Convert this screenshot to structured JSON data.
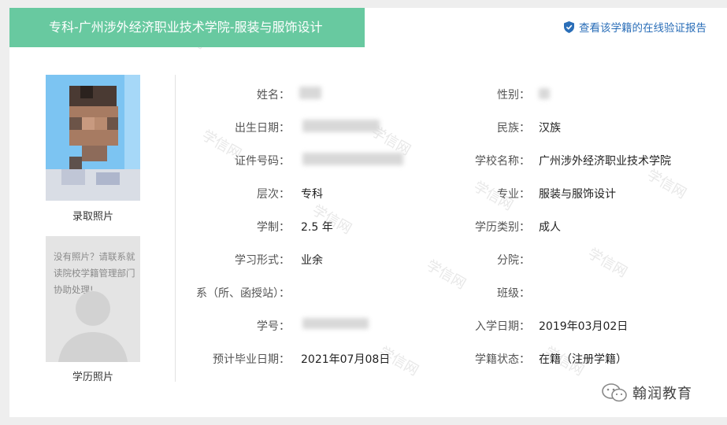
{
  "header": {
    "title": "专科-广州涉外经济职业技术学院-服装与服饰设计",
    "verify_link": "查看该学籍的在线验证报告"
  },
  "photos": {
    "admission_caption": "录取照片",
    "education_caption": "学历照片",
    "placeholder_text": "没有照片？请联系就读院校学籍管理部门协助处理!"
  },
  "left_fields": [
    {
      "label": "姓名：",
      "value": ""
    },
    {
      "label": "出生日期：",
      "value": ""
    },
    {
      "label": "证件号码：",
      "value": ""
    },
    {
      "label": "层次：",
      "value": "专科"
    },
    {
      "label": "学制：",
      "value": "2.5 年"
    },
    {
      "label": "学习形式：",
      "value": "业余"
    },
    {
      "label": "系（所、函授站）：",
      "value": ""
    },
    {
      "label": "学号：",
      "value": ""
    },
    {
      "label": "预计毕业日期：",
      "value": "2021年07月08日"
    }
  ],
  "right_fields": [
    {
      "label": "性别：",
      "value": ""
    },
    {
      "label": "民族：",
      "value": "汉族"
    },
    {
      "label": "学校名称：",
      "value": "广州涉外经济职业技术学院"
    },
    {
      "label": "专业：",
      "value": "服装与服饰设计"
    },
    {
      "label": "学历类别：",
      "value": "成人"
    },
    {
      "label": "分院：",
      "value": ""
    },
    {
      "label": "班级：",
      "value": ""
    },
    {
      "label": "入学日期：",
      "value": "2019年03月02日"
    },
    {
      "label": "学籍状态：",
      "value": "在籍（注册学籍）"
    }
  ],
  "watermark": {
    "text": "学信网"
  },
  "brand": {
    "name": "翰润教育"
  },
  "colors": {
    "header_bg": "#68c9a0",
    "link": "#2a6eb8"
  }
}
